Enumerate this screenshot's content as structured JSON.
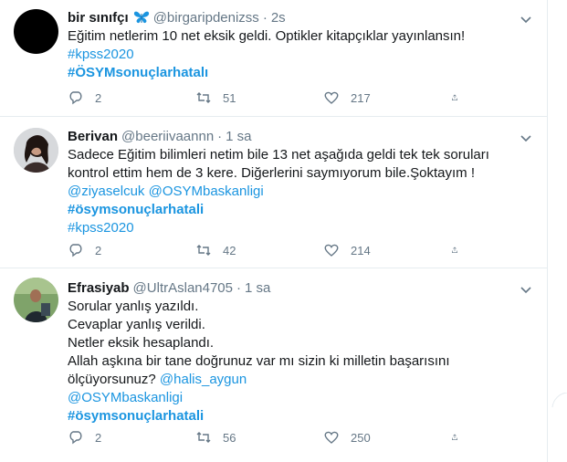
{
  "tweets": [
    {
      "name": "bir sınıfçı",
      "name_icon": "butterfly-icon",
      "handle": "@birgaripdenizss",
      "dot": "·",
      "time": "2s",
      "lines": [
        "Eğitim netlerim 10 net eksik geldi. Optikler kitapçıklar yayınlansın!"
      ],
      "links": [
        "#kpss2020"
      ],
      "tags": [
        "#ÖSYMsonuçlarhatalı"
      ],
      "replies": "2",
      "retweets": "51",
      "likes": "217"
    },
    {
      "name": "Berivan",
      "handle": "@beeriivaannn",
      "dot": "·",
      "time": "1 sa",
      "lines": [
        "Sadece Eğitim bilimleri netim bile 13 net aşağıda geldi tek tek soruları",
        "kontrol ettim hem de 3 kere. Diğerlerini saymıyorum bile.Şoktayım !"
      ],
      "links": [
        "@ziyaselcuk @OSYMbaskanligi"
      ],
      "tags": [
        "#ösymsonuçlarhatali"
      ],
      "links2": [
        "#kpss2020"
      ],
      "replies": "2",
      "retweets": "42",
      "likes": "214"
    },
    {
      "name": "Efrasiyab",
      "handle": "@UltrAslan4705",
      "dot": "·",
      "time": "1 sa",
      "lines": [
        "Sorular yanlış yazıldı.",
        "Cevaplar yanlış verildi.",
        "Netler eksik hesaplandı.",
        "Allah aşkına bir tane doğrunuz var mı sizin ki milletin başarısını"
      ],
      "last_line_text": "ölçüyorsunuz? ",
      "last_line_link": "@halis_aygun",
      "links": [
        "@OSYMbaskanligi"
      ],
      "tags": [
        "#ösymsonuçlarhatali"
      ],
      "replies": "2",
      "retweets": "56",
      "likes": "250"
    }
  ],
  "colors": {
    "link": "#1b95e0",
    "muted": "#657786",
    "border": "#e6ecf0"
  }
}
